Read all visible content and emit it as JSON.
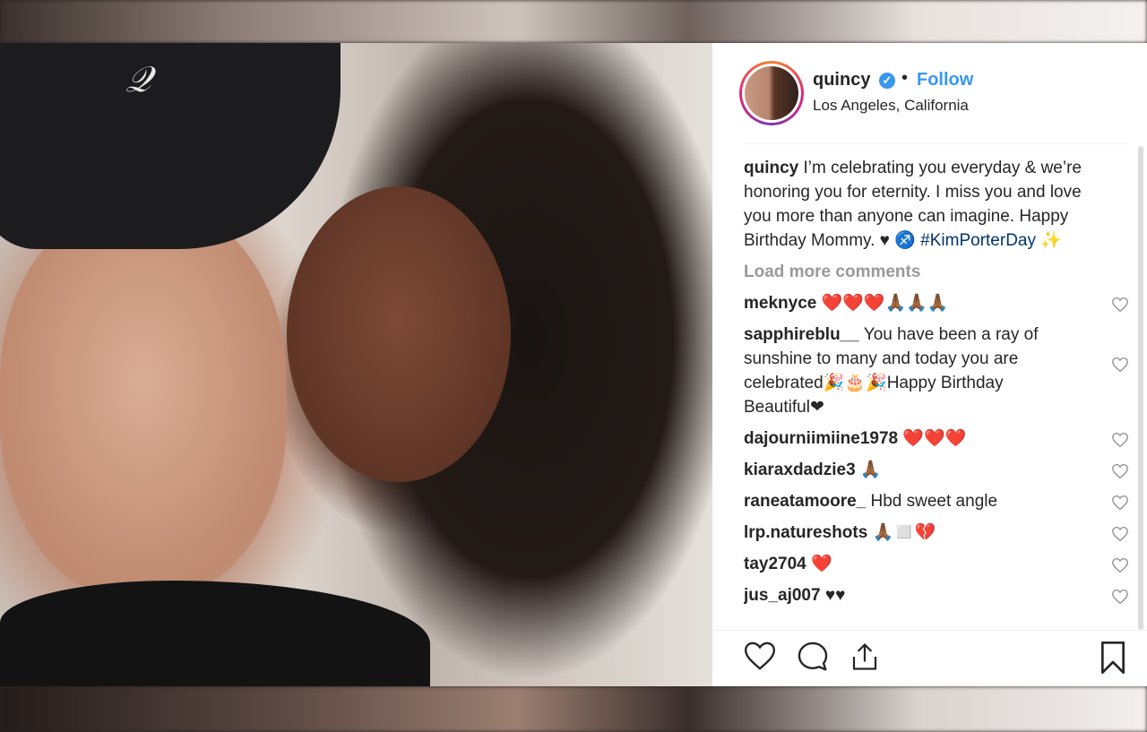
{
  "post": {
    "username": "quincy",
    "verified_icon": "verified-badge-icon",
    "separator": "•",
    "follow_label": "Follow",
    "location": "Los Angeles, California"
  },
  "caption": {
    "username": "quincy",
    "text": " I’m celebrating you everyday & we’re honoring you for eternity. I miss you and love you more than anyone can imagine. Happy Birthday Mommy. ♥ ♐️ ",
    "hashtag": "#KimPorterDay",
    "emoji": " ✨"
  },
  "load_more_label": "Load more comments",
  "comments": [
    {
      "username": "meknyce",
      "text": " ❤️❤️❤️🙏🏾🙏🏾🙏🏾"
    },
    {
      "username": "sapphireblu__",
      "text": " You have been a ray of sunshine to many and today you are celebrated🎉🎂🎉Happy Birthday Beautiful❤"
    },
    {
      "username": "dajourniimiine1978",
      "text": " ❤️❤️❤️"
    },
    {
      "username": "kiaraxdadzie3",
      "text": " 🙏🏾"
    },
    {
      "username": "raneatamoore_",
      "text": " Hbd sweet angle"
    },
    {
      "username": "lrp.natureshots",
      "text": " 🙏🏾◻️💔"
    },
    {
      "username": "tay2704",
      "text": " ❤️"
    },
    {
      "username": "jus_aj007",
      "text": " ♥♥"
    }
  ],
  "actions": {
    "like_icon": "heart-icon",
    "comment_icon": "comment-bubble-icon",
    "share_icon": "share-upload-icon",
    "save_icon": "bookmark-icon"
  },
  "colors": {
    "link_blue": "#3897f0",
    "hashtag_blue": "#003569",
    "muted_gray": "#999999",
    "text_dark": "#262626"
  }
}
